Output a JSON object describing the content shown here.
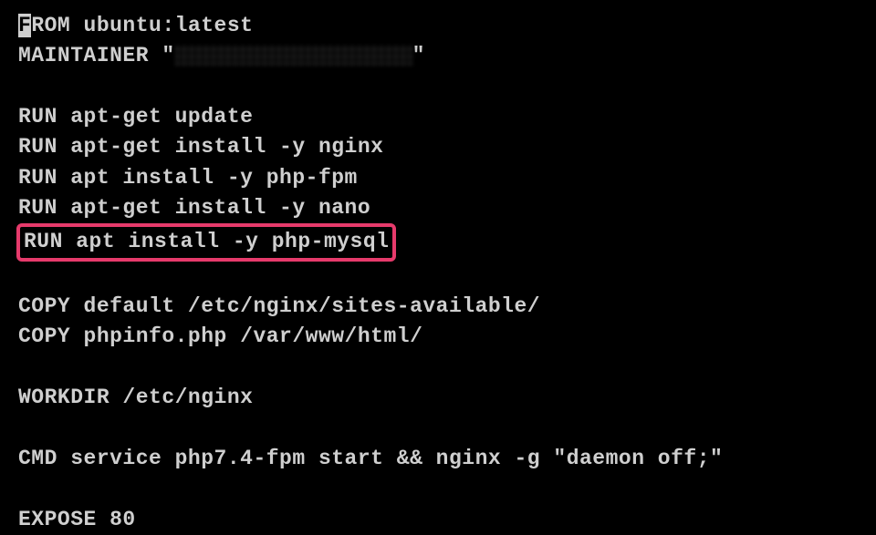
{
  "lines": {
    "l1_first": "F",
    "l1_rest": "ROM ubuntu:latest",
    "l2_pre": "MAINTAINER \"",
    "l2_post": "\"",
    "l3": "RUN apt-get update",
    "l4": "RUN apt-get install -y nginx",
    "l5": "RUN apt install -y php-fpm",
    "l6": "RUN apt-get install -y nano",
    "l7": "RUN apt install -y php-mysql",
    "l8": "COPY default /etc/nginx/sites-available/",
    "l9": "COPY phpinfo.php /var/www/html/",
    "l10": "WORKDIR /etc/nginx",
    "l11": "CMD service php7.4-fpm start && nginx -g \"daemon off;\"",
    "l12": "EXPOSE 80"
  },
  "highlight_color": "#e63a6b"
}
